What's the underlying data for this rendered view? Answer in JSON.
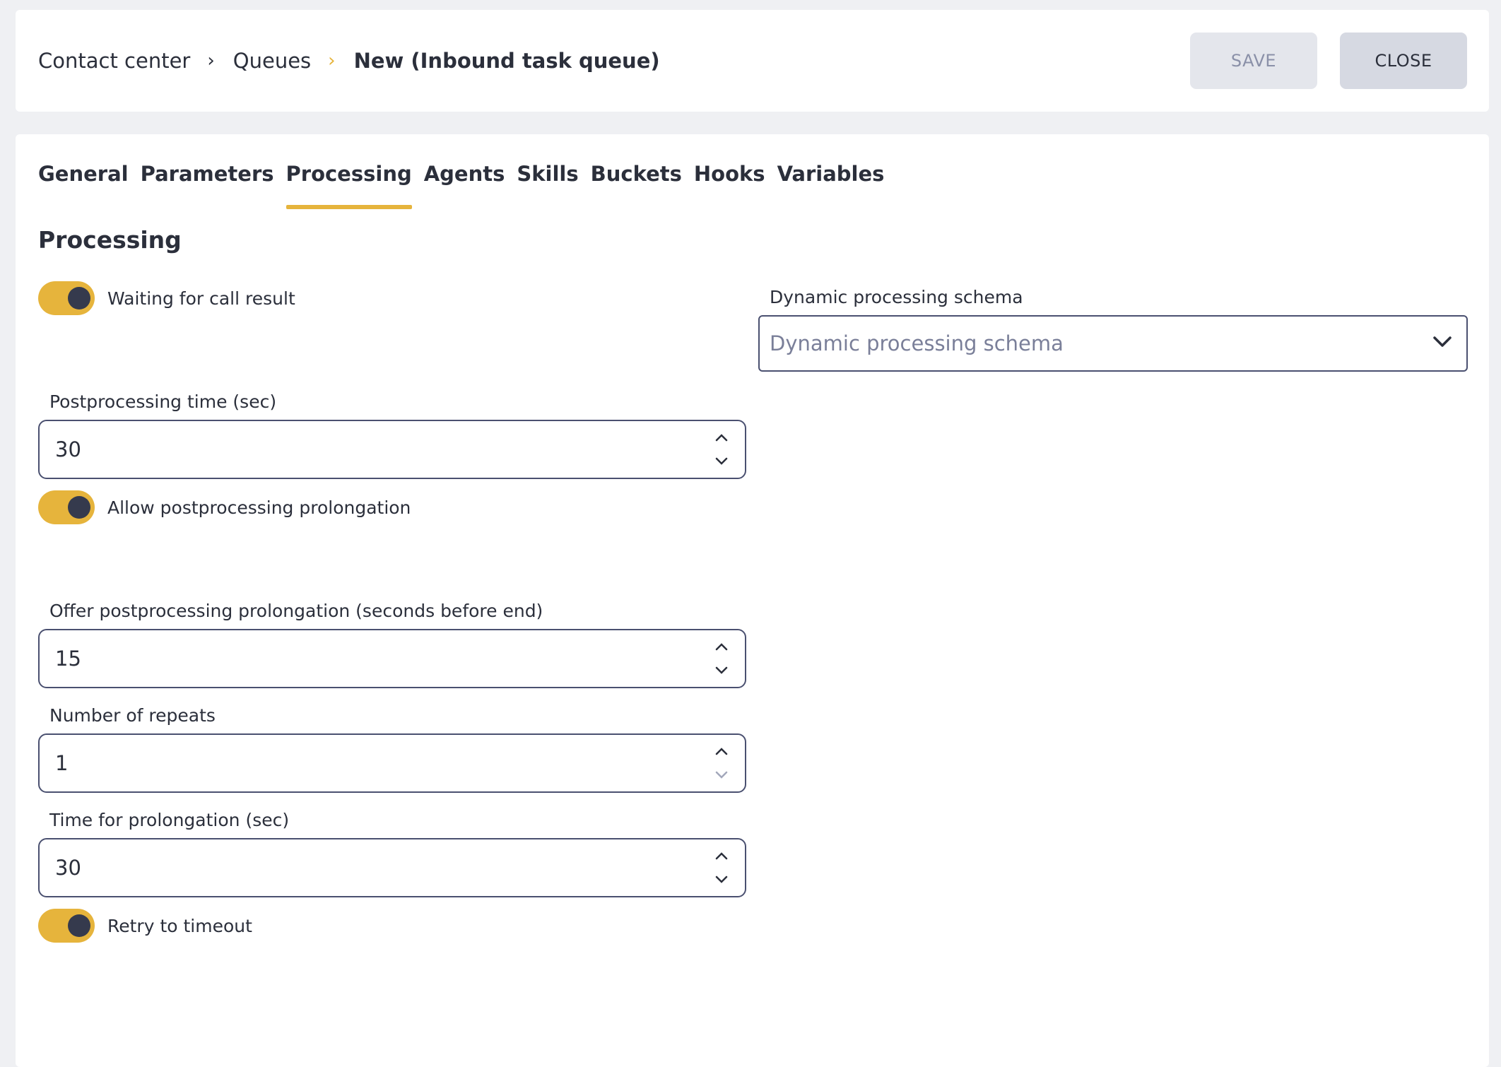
{
  "breadcrumb": {
    "items": [
      "Contact center",
      "Queues"
    ],
    "current": "New (Inbound task queue)",
    "separator": "›"
  },
  "actions": {
    "save_label": "SAVE",
    "close_label": "CLOSE"
  },
  "tabs": [
    {
      "label": "General",
      "active": false
    },
    {
      "label": "Parameters",
      "active": false
    },
    {
      "label": "Processing",
      "active": true
    },
    {
      "label": "Agents",
      "active": false
    },
    {
      "label": "Skills",
      "active": false
    },
    {
      "label": "Buckets",
      "active": false
    },
    {
      "label": "Hooks",
      "active": false
    },
    {
      "label": "Variables",
      "active": false
    }
  ],
  "section": {
    "title": "Processing"
  },
  "toggles": {
    "waiting_for_call_result": {
      "label": "Waiting for call result",
      "on": true
    },
    "allow_postprocessing_prolongation": {
      "label": "Allow postprocessing prolongation",
      "on": true
    },
    "retry_to_timeout": {
      "label": "Retry to timeout",
      "on": true
    }
  },
  "dynamic_schema": {
    "label": "Dynamic processing schema",
    "placeholder": "Dynamic processing schema"
  },
  "fields": {
    "postprocessing_time": {
      "label": "Postprocessing time (sec)",
      "value": "30"
    },
    "offer_prolongation": {
      "label": "Offer postprocessing prolongation (seconds before end)",
      "value": "15"
    },
    "number_of_repeats": {
      "label": "Number of repeats",
      "value": "1"
    },
    "prolongation_time": {
      "label": "Time for prolongation (sec)",
      "value": "30"
    }
  },
  "colors": {
    "accent": "#e6b43c",
    "text": "#2b2f3b",
    "background": "#eff0f3",
    "border": "#4a5070"
  }
}
